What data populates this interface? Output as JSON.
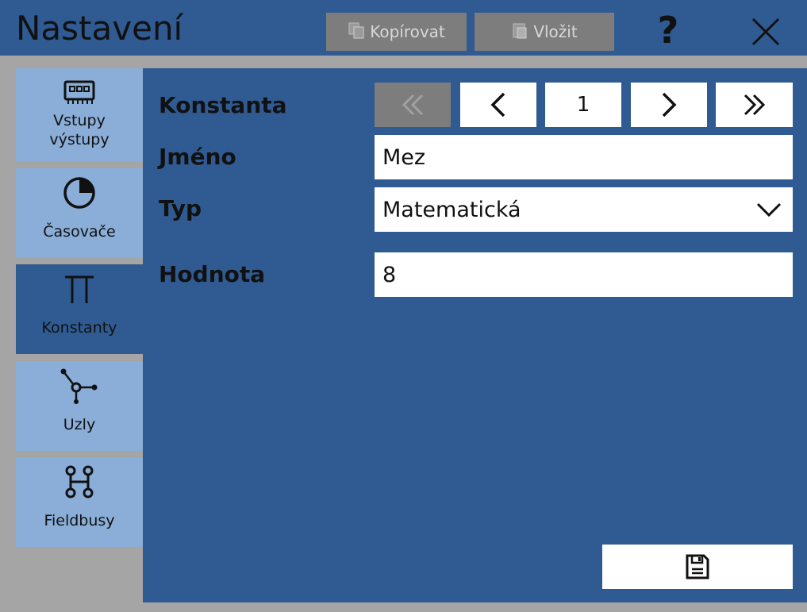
{
  "header": {
    "title": "Nastavení",
    "copy_label": "Kopírovat",
    "paste_label": "Vložit",
    "help_label": "?"
  },
  "sidebar": {
    "items": [
      {
        "label_line1": "Vstupy",
        "label_line2": "výstupy",
        "icon": "io-module-icon"
      },
      {
        "label_line1": "Časovače",
        "icon": "timer-icon"
      },
      {
        "label_line1": "Konstanty",
        "icon": "pi-icon"
      },
      {
        "label_line1": "Uzly",
        "icon": "node-icon"
      },
      {
        "label_line1": "Fieldbusy",
        "icon": "fieldbus-icon"
      }
    ],
    "active_index": 2
  },
  "form": {
    "constant_label": "Konstanta",
    "name_label": "Jméno",
    "type_label": "Typ",
    "value_label": "Hodnota",
    "index_value": "1",
    "name_value": "Mez",
    "type_value": "Matematická",
    "value_value": "8"
  },
  "colors": {
    "panel_blue": "#2f5b92",
    "tab_light_blue": "#8aaed8",
    "disabled_gray": "#7d7d7d",
    "background_gray": "#a5a5a5"
  }
}
